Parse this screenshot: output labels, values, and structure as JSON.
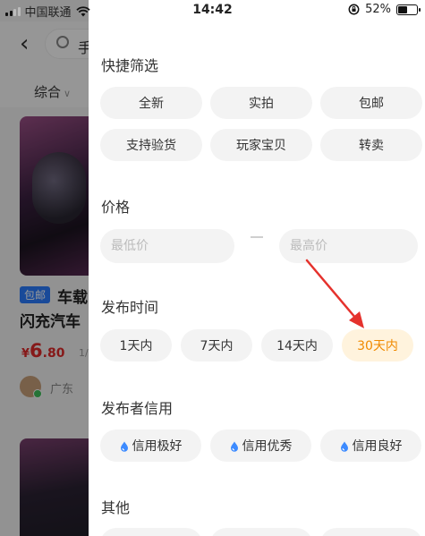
{
  "status_bar": {
    "carrier": "中国联通",
    "time": "14:42",
    "battery": "52%",
    "battery_level": 0.52,
    "icons": [
      "signal-icon",
      "wifi-icon",
      "orientation-lock-icon",
      "battery-icon"
    ]
  },
  "background_page": {
    "search_text": "手",
    "sort_label": "综合",
    "tag": "包邮",
    "item_title_line1": "车载",
    "item_title_line2": "闪充汽车",
    "price_currency": "¥",
    "price_int": "6",
    "price_dec": ".80",
    "want": "1/",
    "location": "广东"
  },
  "filters": {
    "quick": {
      "title": "快捷筛选",
      "chips": [
        "全新",
        "实拍",
        "包邮",
        "支持验货",
        "玩家宝贝",
        "转卖"
      ]
    },
    "price": {
      "title": "价格",
      "min_placeholder": "最低价",
      "max_placeholder": "最高价"
    },
    "publish_time": {
      "title": "发布时间",
      "chips": [
        "1天内",
        "7天内",
        "14天内",
        "30天内"
      ],
      "selected": "30天内"
    },
    "credit": {
      "title": "发布者信用",
      "chips": [
        "信用极好",
        "信用优秀",
        "信用良好"
      ]
    },
    "other": {
      "title": "其他"
    }
  },
  "colors": {
    "accent_text": "#f08a00",
    "accent_bg": "#fff3dd",
    "chip_bg": "#f3f3f3",
    "drop_icon": "#3d8bff",
    "annotation_arrow": "#e5322d",
    "price_red": "#e02a2a",
    "tag_blue": "#2b7cff"
  }
}
